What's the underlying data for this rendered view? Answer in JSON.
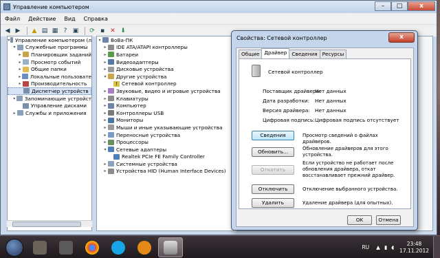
{
  "main_window": {
    "title": "Управление компьютером",
    "controls": {
      "min": "–",
      "max": "□",
      "close": "x"
    },
    "menu": [
      "Файл",
      "Действие",
      "Вид",
      "Справка"
    ]
  },
  "left_tree": [
    {
      "label": "Управление компьютером (л",
      "icon": "computer-management-icon",
      "arrow": "▾"
    },
    {
      "label": "Служебные программы",
      "icon": "tools-icon",
      "arrow": "▾"
    },
    {
      "label": "Планировщик заданий",
      "icon": "task-scheduler-icon",
      "arrow": "▸"
    },
    {
      "label": "Просмотр событий",
      "icon": "event-viewer-icon",
      "arrow": "▸"
    },
    {
      "label": "Общие папки",
      "icon": "shared-folders-icon",
      "arrow": "▸"
    },
    {
      "label": "Локальные пользовате",
      "icon": "users-icon",
      "arrow": "▸"
    },
    {
      "label": "Производительность",
      "icon": "performance-icon",
      "arrow": "▸"
    },
    {
      "label": "Диспетчер устройств",
      "icon": "device-manager-icon",
      "arrow": ""
    },
    {
      "label": "Запоминающие устройст",
      "icon": "storage-icon",
      "arrow": "▾"
    },
    {
      "label": "Управление дисками",
      "icon": "disk-management-icon",
      "arrow": ""
    },
    {
      "label": "Службы и приложения",
      "icon": "services-icon",
      "arrow": "▸"
    }
  ],
  "device_tree": [
    {
      "label": "BoBa-ПК",
      "icon": "computer-icon",
      "arrow": "▾"
    },
    {
      "label": "IDE ATA/ATAPI контроллеры",
      "icon": "ide-icon",
      "arrow": "▸"
    },
    {
      "label": "Батареи",
      "icon": "battery-icon",
      "arrow": "▸"
    },
    {
      "label": "Видеоадаптеры",
      "icon": "display-adapter-icon",
      "arrow": "▸"
    },
    {
      "label": "Дисковые устройства",
      "icon": "disk-icon",
      "arrow": "▸"
    },
    {
      "label": "Другие устройства",
      "icon": "other-devices-icon",
      "arrow": "▾"
    },
    {
      "label": "Сетевой контроллер",
      "icon": "unknown-device-icon",
      "arrow": ""
    },
    {
      "label": "Звуковые, видео и игровые устройства",
      "icon": "sound-icon",
      "arrow": "▸"
    },
    {
      "label": "Клавиатуры",
      "icon": "keyboard-icon",
      "arrow": "▸"
    },
    {
      "label": "Компьютер",
      "icon": "computer-icon",
      "arrow": "▸"
    },
    {
      "label": "Контроллеры USB",
      "icon": "usb-icon",
      "arrow": "▸"
    },
    {
      "label": "Мониторы",
      "icon": "monitor-icon",
      "arrow": "▸"
    },
    {
      "label": "Мыши и иные указывающие устройства",
      "icon": "mouse-icon",
      "arrow": "▸"
    },
    {
      "label": "Переносные устройства",
      "icon": "portable-device-icon",
      "arrow": "▸"
    },
    {
      "label": "Процессоры",
      "icon": "processor-icon",
      "arrow": "▸"
    },
    {
      "label": "Сетевые адаптеры",
      "icon": "network-adapter-icon",
      "arrow": "▾"
    },
    {
      "label": "Realtek PCIe FE Family Controller",
      "icon": "network-card-icon",
      "arrow": ""
    },
    {
      "label": "Системные устройства",
      "icon": "system-devices-icon",
      "arrow": "▸"
    },
    {
      "label": "Устройства HID (Human Interface Devices)",
      "icon": "hid-icon",
      "arrow": "▸"
    }
  ],
  "dialog": {
    "title": "Свойства: Сетевой контроллер",
    "close": "x",
    "tabs": [
      "Общие",
      "Драйвер",
      "Сведения",
      "Ресурсы"
    ],
    "device_name": "Сетевой контроллер",
    "props": [
      {
        "label": "Поставщик драйвера:",
        "value": "Нет данных"
      },
      {
        "label": "Дата разработки:",
        "value": "Нет данных"
      },
      {
        "label": "Версия драйвера:",
        "value": "Нет данных"
      },
      {
        "label": "Цифровая подпись:",
        "value": "Цифровая подпись отсутствует"
      }
    ],
    "actions": [
      {
        "button": "Сведения",
        "desc": "Просмотр сведений о файлах драйверов."
      },
      {
        "button": "Обновить...",
        "desc": "Обновление драйверов для этого устройства."
      },
      {
        "button": "Откатить",
        "desc": "Если устройство не работает после обновления драйвера, откат восстанавливает прежний драйвер."
      },
      {
        "button": "Отключить",
        "desc": "Отключение выбранного устройства."
      },
      {
        "button": "Удалить",
        "desc": "Удаление драйвера (для опытных)."
      }
    ],
    "ok": "OK",
    "cancel": "Отмена"
  },
  "desktop_text": "r\nд",
  "taskbar": {
    "lang": "RU",
    "time": "23:48",
    "date": "17.11.2012"
  }
}
